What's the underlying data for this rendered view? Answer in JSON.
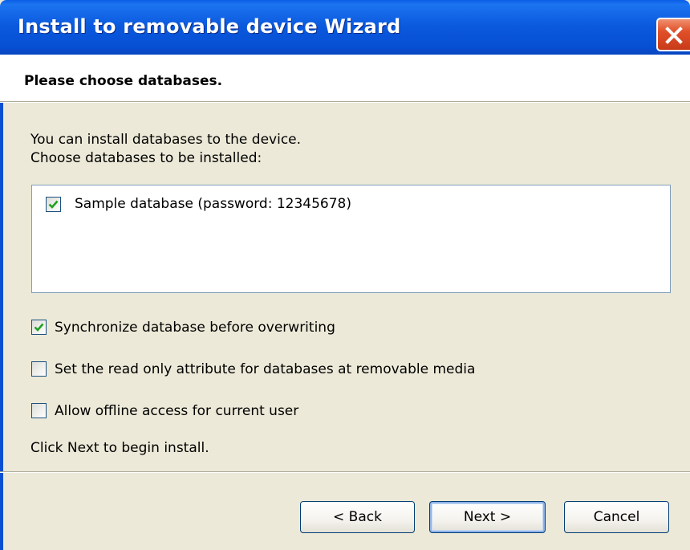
{
  "window": {
    "title": "Install to removable device Wizard",
    "close_icon": "close-icon"
  },
  "header": {
    "title": "Please choose databases."
  },
  "body": {
    "intro_line1": "You can install databases to the device.",
    "intro_line2": "Choose databases to be installed:",
    "databases": [
      {
        "label": "Sample database (password: 12345678)",
        "checked": true
      }
    ],
    "options": [
      {
        "label": "Synchronize database before overwriting",
        "checked": true
      },
      {
        "label": "Set the read only attribute for databases at removable media",
        "checked": false
      },
      {
        "label": "Allow offline access for current user",
        "checked": false
      }
    ],
    "footer_hint": "Click Next to begin install."
  },
  "buttons": {
    "back": "< Back",
    "next": "Next >",
    "cancel": "Cancel"
  },
  "colors": {
    "titlebar": "#0a58dd",
    "close": "#e0502a",
    "checkmark": "#21a121",
    "dialog_bg": "#ece9d8"
  }
}
